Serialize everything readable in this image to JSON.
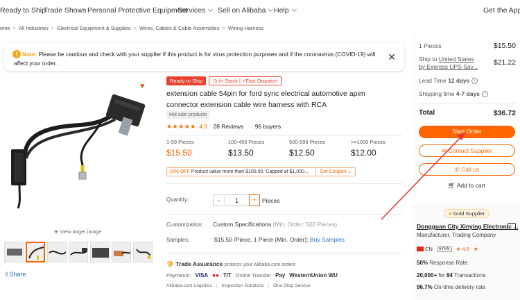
{
  "nav": {
    "items": [
      "Ready to Ship",
      "Trade Shows",
      "Personal Protective Equipment",
      "Services",
      "Sell on Alibaba",
      "Help"
    ],
    "get_app": "Get the App"
  },
  "breadcrumb": [
    "ome",
    "All Industries",
    "Electrical Equipment & Supplies",
    "Wires, Cables & Cable Assemblies",
    "Wiring Harness"
  ],
  "notice": {
    "label": "Note:",
    "text": "Please be cautious and check with your supplier if this product is for virus protection purposes and if the coronavirus (COVID-19) will affect your order."
  },
  "gallery": {
    "view_larger": "View larger image",
    "share": "Share"
  },
  "product": {
    "badge_ready": "Ready to Ship",
    "badge_stock": "In Stock",
    "badge_dispatch": "Fast Dispatch",
    "title": "extension cable 54pin for ford sync electrical automotive apim connector extension cable wire harness with RCA",
    "hot_tag": "Hot sale products",
    "rating": "4.9",
    "reviews": "28 Reviews",
    "buyers": "96 buyers"
  },
  "tiers": [
    {
      "qty": "1-99 Pieces",
      "price": "$15.50"
    },
    {
      "qty": "100-499 Pieces",
      "price": "$13.50"
    },
    {
      "qty": "500-999 Pieces",
      "price": "$12.50"
    },
    {
      "qty": ">=1000 Pieces",
      "price": "$12.00"
    }
  ],
  "coupon": {
    "off": "10% OFF",
    "text": "Product value more than $100.00, Capped at $1,000...",
    "get": "Get Coupon"
  },
  "quantity": {
    "label": "Quantity:",
    "minus": "−",
    "value": "1",
    "plus": "+",
    "unit": "Pieces"
  },
  "customization": {
    "label": "Customization:",
    "value": "Custom Specifications",
    "min": "(Min. Order: 500 Pieces)"
  },
  "samples": {
    "label": "Samples:",
    "value": "$15.50 /Piece, 1 Piece (Min. Order):",
    "link": "Buy Samples"
  },
  "trade_assurance": {
    "title": "Trade Assurance",
    "sub": "protects your Alibaba.com orders"
  },
  "payments": {
    "label": "Payments:",
    "methods": [
      "VISA",
      "●●",
      "T/T",
      "Online Transfer",
      "Pay",
      "WesternUnion WU"
    ]
  },
  "services": [
    "Alibaba.com Logistics",
    "Inspection Solutions",
    "One-Stop Service"
  ],
  "order_panel": {
    "pieces": "1 Pieces",
    "pieces_price": "$15.50",
    "ship_to": "Ship to",
    "ship_country": "United States",
    "ship_by": "by Express UPS Sav...",
    "ship_price": "$21.22",
    "lead_label": "Lead Time",
    "lead_value": "12 days",
    "shipping_label": "Shipping time",
    "shipping_value": "4-7 days",
    "total_label": "Total",
    "total_value": "$36.72",
    "start_order": "Start Order",
    "contact": "Contact Supplier",
    "call": "Call us",
    "add_cart": "Add to cart"
  },
  "supplier": {
    "badge": "Gold Supplier",
    "name": "Dongguan City Xinying Electronic ...",
    "type": "Manufacturer, Trading Company",
    "country": "CN",
    "years": "6YRS",
    "score": "4.8",
    "response_rate": "50%",
    "response_label": "Response Rate",
    "transactions_a": "20,000+",
    "transactions_mid": "for",
    "transactions_b": "94",
    "transactions_label": "Transactions",
    "ontime": "96.7%",
    "ontime_label": "On-time delivery rate"
  },
  "colors": {
    "accent": "#ff6600",
    "link": "#2a70c8",
    "annotation_arrow": "#e53935"
  }
}
